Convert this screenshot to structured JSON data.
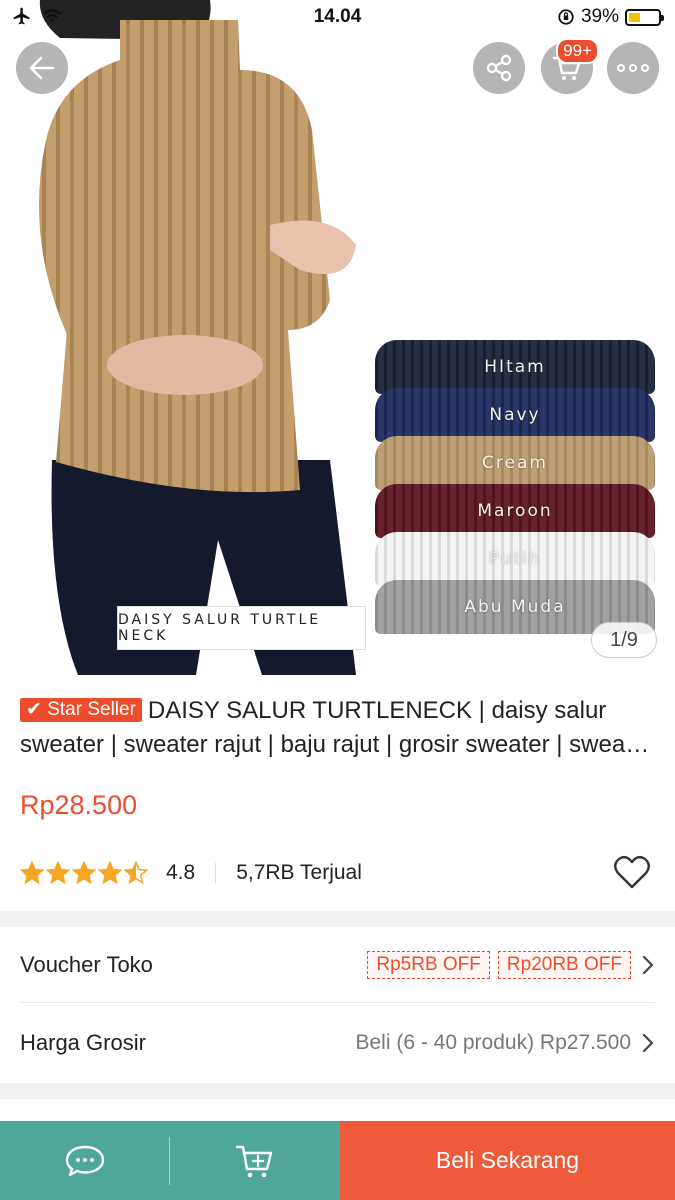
{
  "status_bar": {
    "time": "14.04",
    "battery_text": "39%",
    "battery_level": 0.39,
    "icons": [
      "airplane-icon",
      "wifi-icon",
      "rotation-lock-icon",
      "battery-icon"
    ]
  },
  "top_actions": {
    "back_icon": "back-arrow-icon",
    "share_icon": "share-icon",
    "cart_icon": "cart-icon",
    "cart_badge": "99+",
    "more_icon": "more-dots-icon"
  },
  "gallery": {
    "colors": [
      {
        "name": "HItam",
        "color": "#1b2236"
      },
      {
        "name": "Navy",
        "color": "#1f2b5e"
      },
      {
        "name": "Cream",
        "color": "#b99a6b"
      },
      {
        "name": "Maroon",
        "color": "#5c1520"
      },
      {
        "name": "Putih",
        "color": "#f4f4f4"
      },
      {
        "name": "Abu Muda",
        "color": "#9c9c9c"
      }
    ],
    "caption": "DAISY SALUR TURTLE NECK",
    "counter": "1/9"
  },
  "product": {
    "badge": "Star Seller",
    "title": "DAISY SALUR TURTLENECK | daisy salur sweater | sweater rajut | baju rajut | grosir sweater | sweater wanita",
    "price": "Rp28.500",
    "rating": "4.8",
    "rating_value": 4.5,
    "sold": "5,7RB Terjual"
  },
  "voucher": {
    "label": "Voucher Toko",
    "tags": [
      "Rp5RB OFF",
      "Rp20RB OFF"
    ]
  },
  "wholesale": {
    "label": "Harga Grosir",
    "value": "Beli (6 - 40 produk) Rp27.500"
  },
  "bottom_bar": {
    "chat_icon": "chat-icon",
    "add_cart_icon": "add-to-cart-icon",
    "buy_label": "Beli Sekarang"
  },
  "colors": {
    "accent": "#ee4d2d",
    "bottom_left_bg": "#4fa897",
    "buy_bg": "#ee5a3a",
    "star": "#f6a623"
  }
}
